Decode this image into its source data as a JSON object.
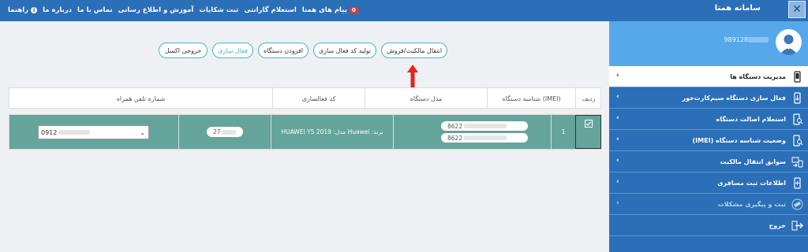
{
  "header": {
    "brand": "سامانه همتا",
    "close_symbol": "✕",
    "nav": [
      {
        "label": "پیام های همتا",
        "badge": "0"
      },
      {
        "label": "استعلام گارانتی"
      },
      {
        "label": "ثبت شکایات"
      },
      {
        "label": "آموزش و اطلاع رسانی"
      },
      {
        "label": "تماس با ما"
      },
      {
        "label": "درباره ما"
      },
      {
        "label": "راهنما"
      }
    ]
  },
  "user": {
    "phone": "989128"
  },
  "sidebar": {
    "items": [
      {
        "label": "مدیریت دستگاه ها",
        "icon": "phone-device-icon",
        "active": true
      },
      {
        "label": "فعال سازی دستگاه سیم‌کارت‌خور",
        "icon": "phone-arrow-icon"
      },
      {
        "label": "استعلام اصالت دستگاه",
        "icon": "phone-search-icon"
      },
      {
        "label": "وضعیت شناسه دستگاه (IMEI)",
        "icon": "phone-search-icon"
      },
      {
        "label": "سوابق انتقال مالکیت",
        "icon": "device-transfer-icon"
      },
      {
        "label": "اطلاعات ثبت مسافری",
        "icon": "phone-plus-icon"
      },
      {
        "label": "ثبت و پیگیری مشکلات",
        "icon": "feedback-icon",
        "disabled": true
      },
      {
        "label": "خروج",
        "icon": "exit-icon"
      }
    ]
  },
  "actions": {
    "transfer": "انتقال مالکیت/فروش",
    "generate_code": "تولید کد فعال سازی",
    "add_device": "افزودن دستگاه",
    "activate": "فعال سازی",
    "export_excel": "خروجی اکسل"
  },
  "table": {
    "headers": {
      "row": "ردیف",
      "imei": "شناسه دستگاه (IMEI)",
      "model": "مدل دستگاه",
      "code": "کد فعالسازی",
      "phone": "شماره تلفن همراه"
    },
    "rows": [
      {
        "index": "1",
        "imei1": "8622",
        "imei2": "8622",
        "model": "برند: Huawei  مدل: HUAWEI Y5 2019",
        "code": "27",
        "phone": "0912"
      }
    ]
  },
  "colors": {
    "topbar": "#2a6fb7",
    "sidebar": "#2a6fb7",
    "user_box": "#56a8ea",
    "row": "#65a49b",
    "accent": "#49b7c2",
    "arrow": "#e0271c"
  }
}
